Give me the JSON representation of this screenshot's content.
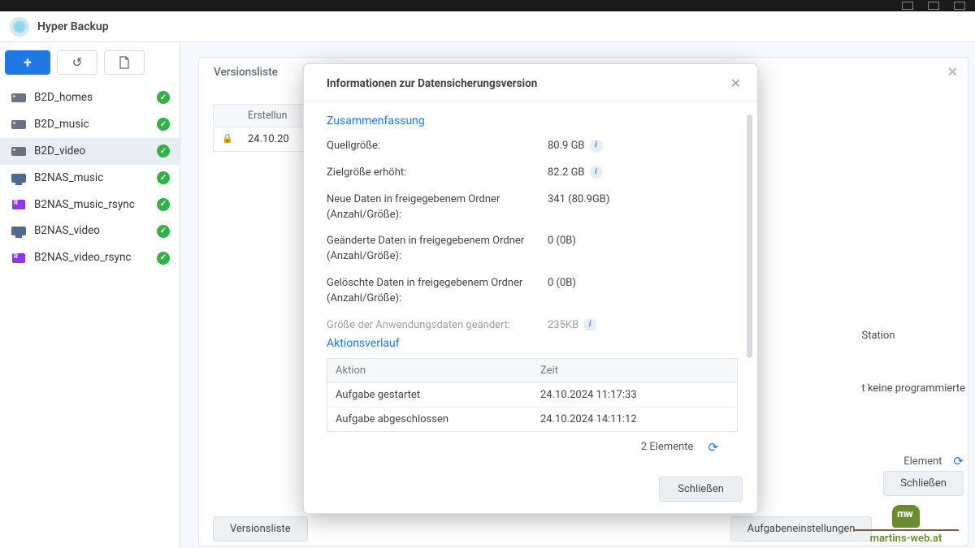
{
  "app": {
    "title": "Hyper Backup"
  },
  "sidebar": {
    "items": [
      {
        "label": "B2D_homes",
        "icon": "nas"
      },
      {
        "label": "B2D_music",
        "icon": "nas"
      },
      {
        "label": "B2D_video",
        "icon": "nas",
        "selected": true
      },
      {
        "label": "B2NAS_music",
        "icon": "sync"
      },
      {
        "label": "B2NAS_music_rsync",
        "icon": "rsync"
      },
      {
        "label": "B2NAS_video",
        "icon": "sync"
      },
      {
        "label": "B2NAS_video_rsync",
        "icon": "rsync"
      }
    ]
  },
  "panel": {
    "title": "Versionsliste",
    "col_created": "Erstellun",
    "row_date": "24.10.20",
    "btn_versionlist": "Versionsliste",
    "btn_tasksettings": "Aufgabeneinstellungen",
    "right_text1": "Station",
    "right_text2": "t keine programmierte",
    "right_count": "Element",
    "outer_close": "Schließen"
  },
  "modal": {
    "title": "Informationen zur Datensicherungsversion",
    "section_summary": "Zusammenfassung",
    "rows": [
      {
        "k": "Quellgröße:",
        "v": "80.9 GB",
        "info": true
      },
      {
        "k": "Zielgröße erhöht:",
        "v": "82.2 GB",
        "info": true
      },
      {
        "k": "Neue Daten in freigegebenem Ordner (Anzahl/Größe):",
        "v": "341 (80.9GB)"
      },
      {
        "k": "Geänderte Daten in freigegebenem Ordner (Anzahl/Größe):",
        "v": "0 (0B)"
      },
      {
        "k": "Gelöschte Daten in freigegebenem Ordner (Anzahl/Größe):",
        "v": "0 (0B)"
      }
    ],
    "cutoff_k": "Größe der Anwendungsdaten geändert:",
    "cutoff_v": "235KB",
    "section_log": "Aktionsverlauf",
    "log_col_action": "Aktion",
    "log_col_time": "Zeit",
    "log": [
      {
        "a": "Aufgabe gestartet",
        "t": "24.10.2024 11:17:33"
      },
      {
        "a": "Aufgabe abgeschlossen",
        "t": "24.10.2024 14:11:12"
      }
    ],
    "count": "2 Elemente",
    "close": "Schließen"
  },
  "watermark": "martins-web.at"
}
